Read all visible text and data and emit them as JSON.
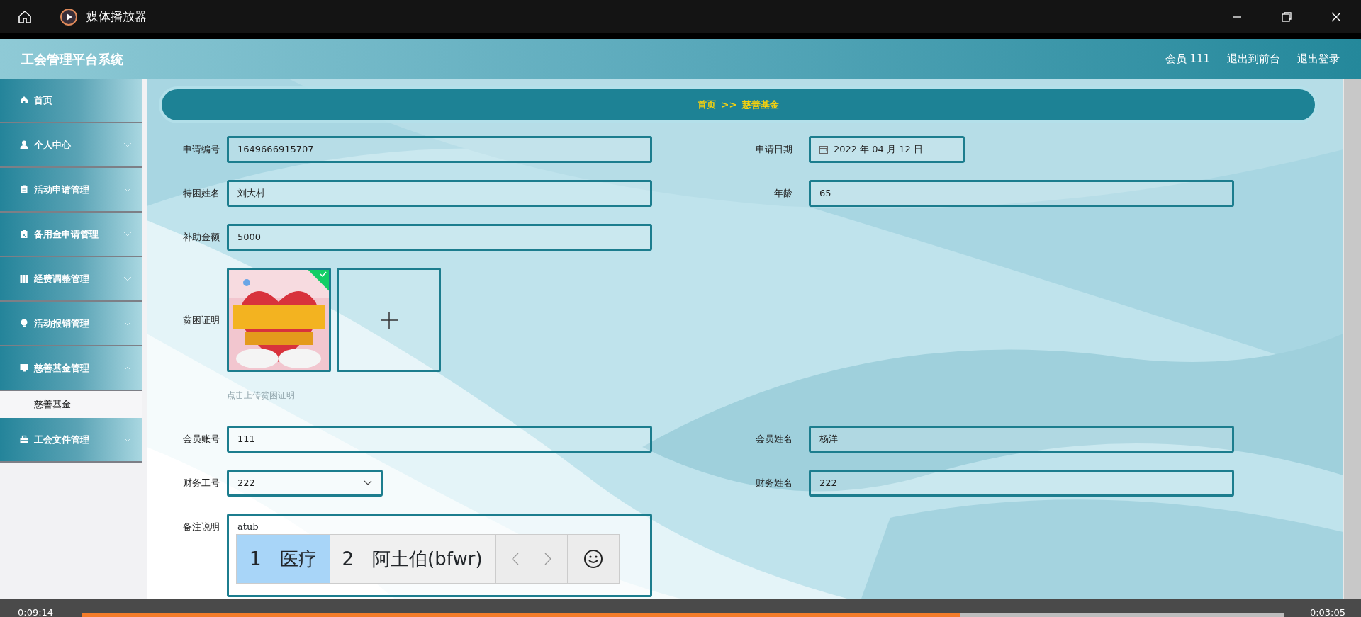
{
  "player": {
    "title": "媒体播放器",
    "elapsed": "0:09:14",
    "remaining": "0:03:05",
    "level": 0.73
  },
  "app": {
    "title": "工会管理平台系统",
    "user_links": [
      "会员 111",
      "退出到前台",
      "退出登录"
    ]
  },
  "sidebar": {
    "items": [
      {
        "label": "首页",
        "expandable": false
      },
      {
        "label": "个人中心",
        "expandable": true,
        "expanded": false
      },
      {
        "label": "活动申请管理",
        "expandable": true,
        "expanded": false
      },
      {
        "label": "备用金申请管理",
        "expandable": true,
        "expanded": false
      },
      {
        "label": "经费调整管理",
        "expandable": true,
        "expanded": false
      },
      {
        "label": "活动报销管理",
        "expandable": true,
        "expanded": false
      },
      {
        "label": "慈善基金管理",
        "expandable": true,
        "expanded": true,
        "children": [
          {
            "label": "慈善基金",
            "selected": true
          }
        ]
      },
      {
        "label": "工会文件管理",
        "expandable": true,
        "expanded": false
      }
    ]
  },
  "breadcrumb": {
    "items": [
      "首页",
      "慈善基金"
    ],
    "separator": ">>"
  },
  "form": {
    "rows": [
      [
        {
          "label": "申请编号",
          "kind": "text",
          "value": "1649666915707"
        },
        {
          "label": "申请日期",
          "kind": "date",
          "value": "2022 年 04 月 12 日"
        }
      ],
      [
        {
          "label": "特困姓名",
          "kind": "text",
          "value": "刘大村"
        },
        {
          "label": "年龄",
          "kind": "text",
          "value": "65"
        }
      ],
      [
        {
          "label": "补助金额",
          "kind": "text",
          "value": "5000"
        }
      ],
      [
        {
          "label": "贫困证明",
          "kind": "upload",
          "uploaded": true,
          "hint": "点击上传贫困证明"
        }
      ],
      [
        {
          "label": "会员账号",
          "kind": "text",
          "value": "111"
        },
        {
          "label": "会员姓名",
          "kind": "text",
          "value": "杨洋"
        }
      ],
      [
        {
          "label": "财务工号",
          "kind": "select",
          "value": "222"
        },
        {
          "label": "财务姓名",
          "kind": "text",
          "value": "222"
        }
      ],
      [
        {
          "label": "备注说明",
          "kind": "textarea",
          "value": "atub"
        }
      ]
    ]
  },
  "ime": {
    "candidates": [
      {
        "index": "1",
        "text": "医疗",
        "selected": true
      },
      {
        "index": "2",
        "text": "阿土伯(bfwr)",
        "selected": false
      }
    ]
  }
}
